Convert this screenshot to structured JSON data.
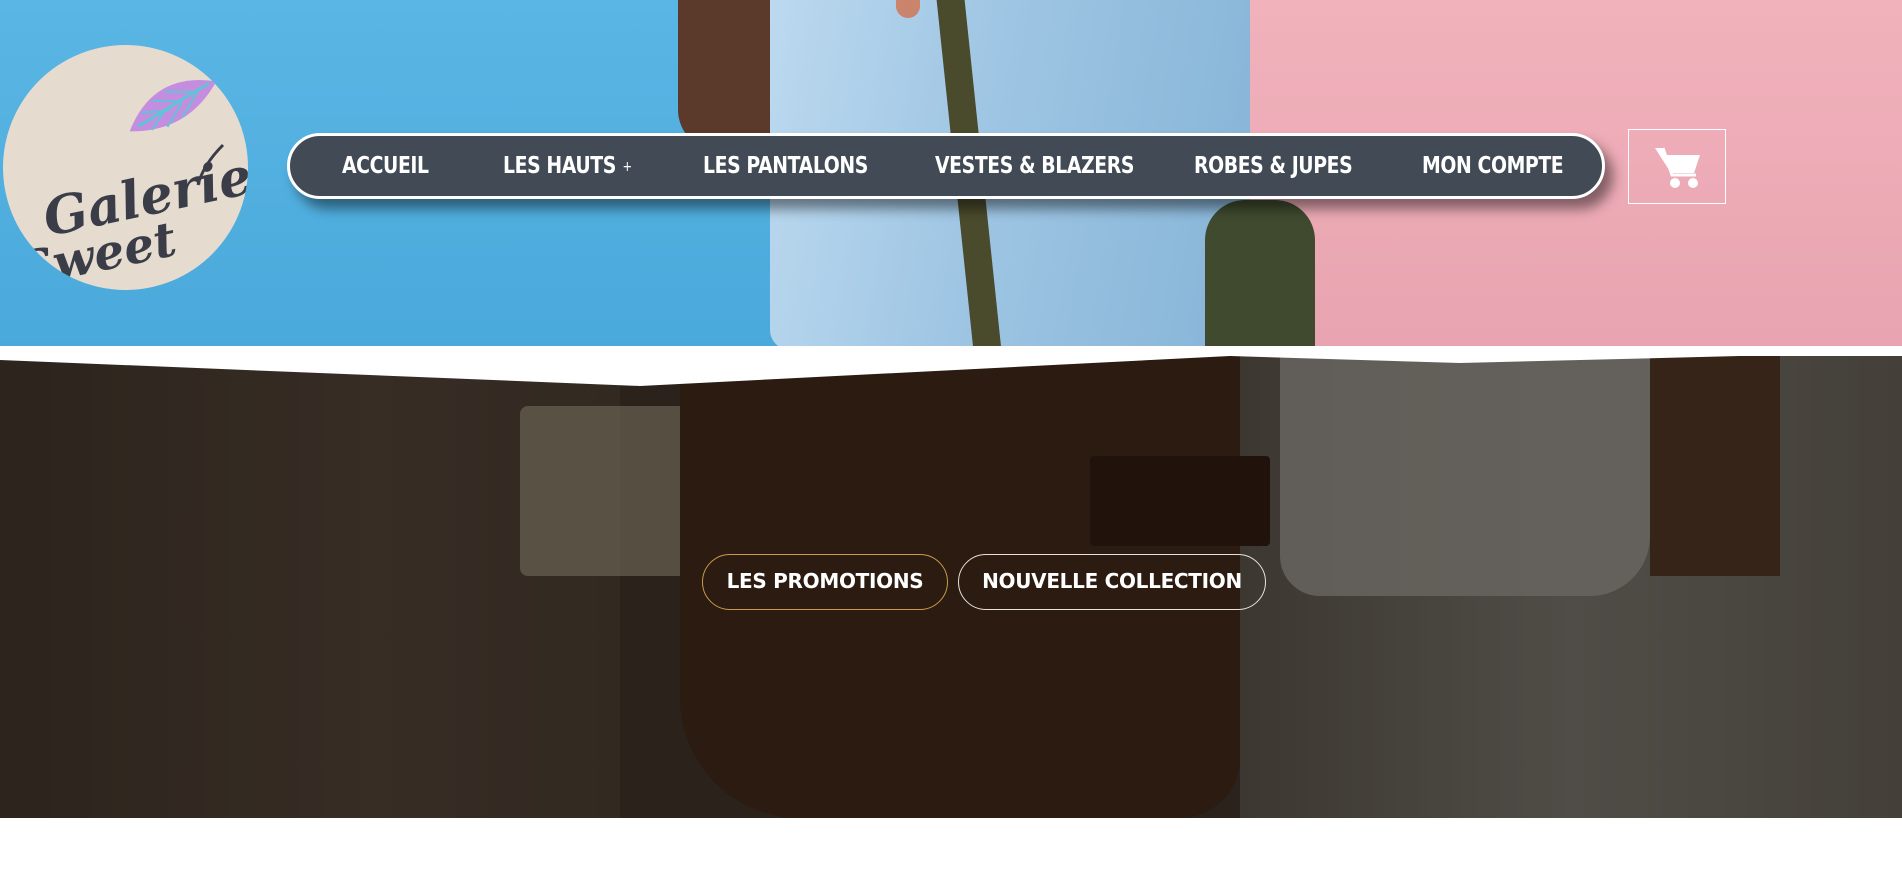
{
  "logo": {
    "line1": "Galerie",
    "line2": "Sweet"
  },
  "nav": {
    "items": [
      {
        "label": "ACCUEIL"
      },
      {
        "label": "LES HAUTS",
        "expander": "+"
      },
      {
        "label": "LES PANTALONS"
      },
      {
        "label": "VESTES & BLAZERS"
      },
      {
        "label": "ROBES & JUPES"
      },
      {
        "label": "MON COMPTE"
      }
    ]
  },
  "cart": {
    "icon": "shopping-cart-icon"
  },
  "hero": {
    "buttons": {
      "promotions": "LES PROMOTIONS",
      "new_collection": "NOUVELLE COLLECTION"
    }
  },
  "colors": {
    "nav_background": "#414a55",
    "promo_border": "#c99a4c",
    "sky_blue": "#4aa9db",
    "pink": "#e8a4b0",
    "logo_bg": "#e5dccf",
    "logo_text": "#3a3d48"
  }
}
